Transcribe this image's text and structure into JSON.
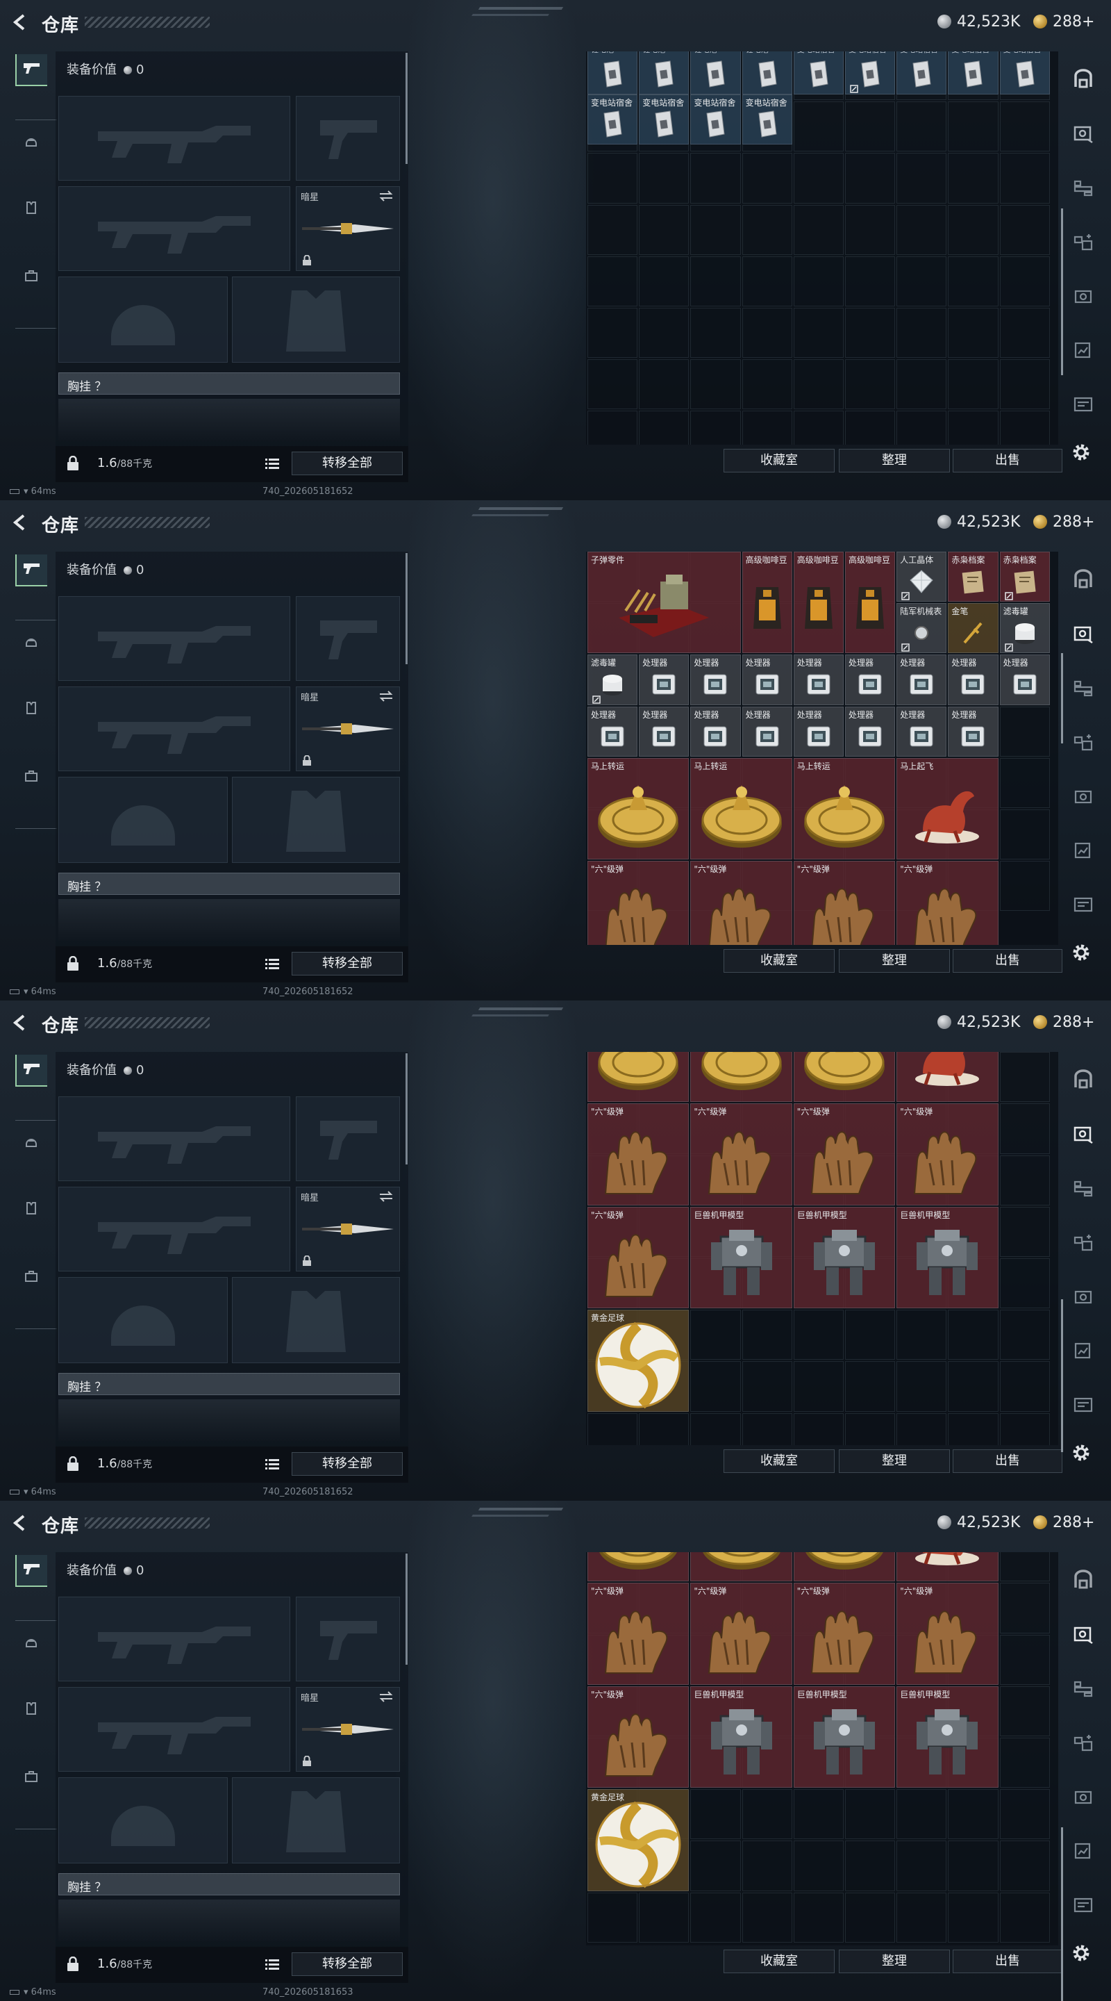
{
  "header": {
    "title": "仓库",
    "currency_silver": "42,523K",
    "currency_gold": "288+"
  },
  "left_nav": {
    "items": [
      {
        "icon": "pistol-icon"
      },
      {
        "icon": "helmet-icon"
      },
      {
        "icon": "vest-icon"
      },
      {
        "icon": "backpack-icon"
      }
    ]
  },
  "equipment": {
    "value_label": "装备价值",
    "value": "0",
    "secondary_label": "暗星",
    "chest_label": "胸挂 ？",
    "weight": "1.6",
    "weight_max": "/88千克",
    "transfer_all": "转移全部"
  },
  "actions": {
    "collection": "收藏室",
    "organize": "整理",
    "sell": "出售"
  },
  "status": {
    "ping": "64ms",
    "builds": [
      "740_202605181652",
      "740_202605181652",
      "740_202605181652",
      "740_202605181653"
    ]
  },
  "labels": {
    "lithium": "锂电池",
    "shanglin": "变电站宿舍",
    "bullet_parts": "子弹零件",
    "coffee": "高级咖啡豆",
    "gem": "人工晶体",
    "redfox": "赤枭档案",
    "pen": "金笔",
    "forest_watch": "陆军机械表",
    "filter": "滤毒罐",
    "processor": "处理器",
    "horse_run": "马上转运",
    "horse_fly": "马上起飞",
    "six": "\"六\"级弹",
    "mecha": "巨兽机甲模型",
    "football": "黄金足球"
  }
}
